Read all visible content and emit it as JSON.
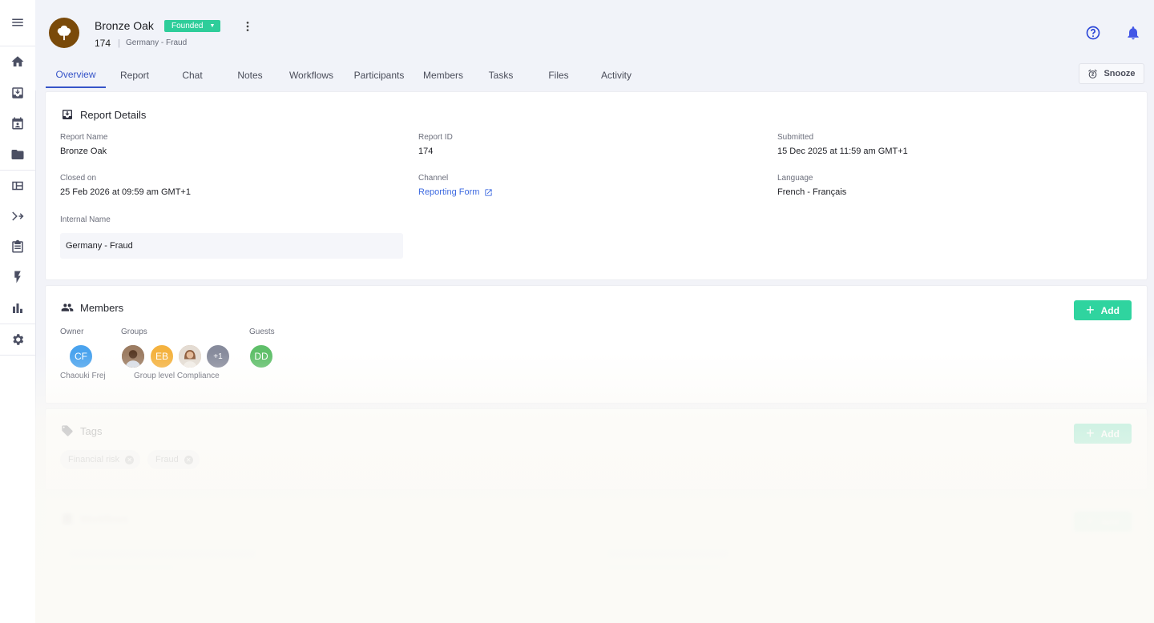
{
  "header": {
    "title": "Bronze Oak",
    "status_badge": "Founded",
    "report_id": "174",
    "internal_name": "Germany - Fraud",
    "snooze_label": "Snooze"
  },
  "tabs": [
    {
      "label": "Overview",
      "active": true
    },
    {
      "label": "Report"
    },
    {
      "label": "Chat"
    },
    {
      "label": "Notes"
    },
    {
      "label": "Workflows"
    },
    {
      "label": "Participants"
    },
    {
      "label": "Members"
    },
    {
      "label": "Tasks"
    },
    {
      "label": "Files"
    },
    {
      "label": "Activity"
    }
  ],
  "sidebar": {
    "icons": [
      "menu-icon",
      "home-icon",
      "inbox-icon",
      "calendar-icon",
      "folder-icon",
      "table-icon",
      "merge-icon",
      "clipboard-icon",
      "bolt-icon",
      "bar-chart-icon",
      "settings-icon"
    ]
  },
  "report_details": {
    "title": "Report Details",
    "fields": {
      "report_name_label": "Report Name",
      "report_name": "Bronze Oak",
      "report_id_label": "Report ID",
      "report_id": "174",
      "submitted_label": "Submitted",
      "submitted": "15 Dec 2025 at 11:59 am GMT+1",
      "closed_on_label": "Closed on",
      "closed_on": "25 Feb 2026 at 09:59 am GMT+1",
      "channel_label": "Channel",
      "channel": "Reporting Form",
      "language_label": "Language",
      "language": "French - Français",
      "internal_name_label": "Internal Name",
      "internal_name": "Germany - Fraud"
    }
  },
  "members": {
    "title": "Members",
    "add_label": "Add",
    "owner_label": "Owner",
    "groups_label": "Groups",
    "guests_label": "Guests",
    "owner": {
      "initials": "CF",
      "name": "Chaouki Frej",
      "color": "#4aa3ee"
    },
    "groups": {
      "name": "Group level Compliance",
      "avatars": [
        {
          "initials": "",
          "photo": true,
          "color": "#8a6a52"
        },
        {
          "initials": "EB",
          "color": "#f4b23f"
        },
        {
          "initials": "",
          "photo": true,
          "color": "#c9a48a"
        },
        {
          "initials": "+1",
          "color": "#878b9c"
        }
      ]
    },
    "guests": [
      {
        "initials": "DD",
        "color": "#5fbf6a"
      }
    ]
  },
  "tags": {
    "title": "Tags",
    "add_label": "Add",
    "items": [
      "Financial risk",
      "Fraud"
    ]
  },
  "workflows": {
    "title": "Workflows",
    "add_label": "Add"
  },
  "colors": {
    "accent": "#3654c8",
    "add_button": "#2fd49f",
    "badge": "#2ecd9a",
    "link": "#3e6ae0"
  }
}
